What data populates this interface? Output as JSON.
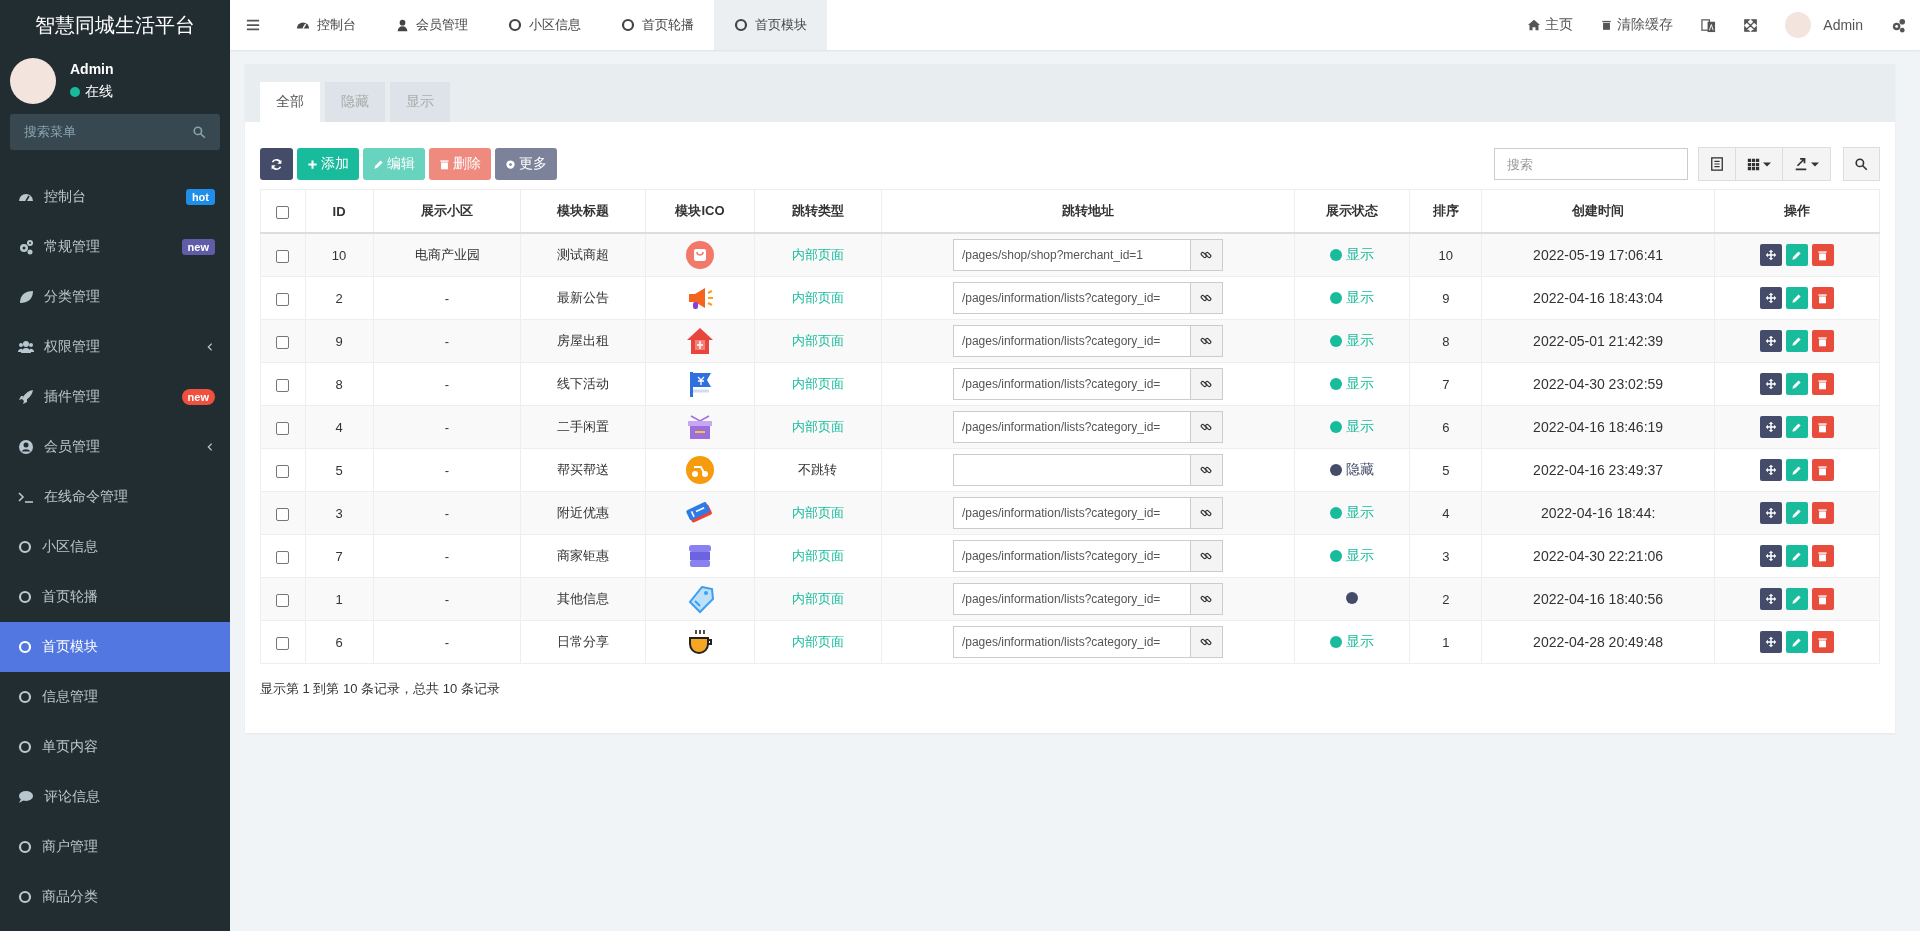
{
  "app_title": "智慧同城生活平台",
  "user": {
    "name": "Admin",
    "status": "在线"
  },
  "menu_search": {
    "placeholder": "搜索菜单"
  },
  "sidebar": {
    "items": [
      {
        "label": "控制台",
        "selected": false,
        "badge": {
          "text": "hot",
          "color": "#1e8ee8"
        }
      },
      {
        "label": "常规管理",
        "selected": false,
        "badge": {
          "text": "new",
          "color": "#605ca8"
        }
      },
      {
        "label": "分类管理",
        "selected": false
      },
      {
        "label": "权限管理",
        "selected": false,
        "expanded": false
      },
      {
        "label": "插件管理",
        "selected": false,
        "badge": {
          "text": "new",
          "color": "#f0503f"
        }
      },
      {
        "label": "会员管理",
        "selected": false,
        "expanded": false
      },
      {
        "label": "在线命令管理",
        "selected": false
      },
      {
        "label": "小区信息",
        "selected": false
      },
      {
        "label": "首页轮播",
        "selected": false
      },
      {
        "label": "首页模块",
        "selected": true
      },
      {
        "label": "信息管理",
        "selected": false
      },
      {
        "label": "单页内容",
        "selected": false
      },
      {
        "label": "评论信息",
        "selected": false
      },
      {
        "label": "商户管理",
        "selected": false
      },
      {
        "label": "商品分类",
        "selected": false
      }
    ]
  },
  "nav_tabs": [
    {
      "label": "控制台",
      "selected": false
    },
    {
      "label": "会员管理",
      "selected": false
    },
    {
      "label": "小区信息",
      "selected": false
    },
    {
      "label": "首页轮播",
      "selected": false
    },
    {
      "label": "首页模块",
      "selected": true
    }
  ],
  "top_right": {
    "home": "主页",
    "clear_cache": "清除缓存",
    "user": "Admin"
  },
  "filter_tabs": [
    {
      "label": "全部",
      "selected": true
    },
    {
      "label": "隐藏",
      "selected": false
    },
    {
      "label": "显示",
      "selected": false
    }
  ],
  "toolbar": {
    "buttons": [
      {
        "kind": "refresh",
        "disabled": false
      },
      {
        "kind": "add",
        "label": "添加",
        "disabled": false
      },
      {
        "kind": "edit",
        "label": "编辑",
        "disabled": true
      },
      {
        "kind": "delete",
        "label": "删除",
        "disabled": true
      },
      {
        "kind": "more",
        "label": "更多",
        "disabled": false
      }
    ],
    "search": {
      "placeholder": "搜索"
    }
  },
  "table": {
    "select_all": {
      "checked": false
    },
    "columns": [
      "ID",
      "展示小区",
      "模块标题",
      "模块ICO",
      "跳转类型",
      "跳转地址",
      "展示状态",
      "排序",
      "创建时间",
      "操作"
    ],
    "rows": [
      {
        "checked": false,
        "id": "10",
        "community": "电商产业园",
        "title": "测试商超",
        "jump_type": {
          "kind": "internal",
          "label": "内部页面"
        },
        "url": "/pages/shop/shop?merchant_id=1",
        "status": {
          "visible": true,
          "label": "显示"
        },
        "sort": "10",
        "created": "2022-05-19 17:06:41"
      },
      {
        "checked": false,
        "id": "2",
        "community": "-",
        "title": "最新公告",
        "jump_type": {
          "kind": "internal",
          "label": "内部页面"
        },
        "url": "/pages/information/lists?category_id=",
        "status": {
          "visible": true,
          "label": "显示"
        },
        "sort": "9",
        "created": "2022-04-16 18:43:04"
      },
      {
        "checked": false,
        "id": "9",
        "community": "-",
        "title": "房屋出租",
        "jump_type": {
          "kind": "internal",
          "label": "内部页面"
        },
        "url": "/pages/information/lists?category_id=",
        "status": {
          "visible": true,
          "label": "显示"
        },
        "sort": "8",
        "created": "2022-05-01 21:42:39"
      },
      {
        "checked": false,
        "id": "8",
        "community": "-",
        "title": "线下活动",
        "jump_type": {
          "kind": "internal",
          "label": "内部页面"
        },
        "url": "/pages/information/lists?category_id=",
        "status": {
          "visible": true,
          "label": "显示"
        },
        "sort": "7",
        "created": "2022-04-30 23:02:59"
      },
      {
        "checked": false,
        "id": "4",
        "community": "-",
        "title": "二手闲置",
        "jump_type": {
          "kind": "internal",
          "label": "内部页面"
        },
        "url": "/pages/information/lists?category_id=",
        "status": {
          "visible": true,
          "label": "显示"
        },
        "sort": "6",
        "created": "2022-04-16 18:46:19"
      },
      {
        "checked": false,
        "id": "5",
        "community": "-",
        "title": "帮买帮送",
        "jump_type": {
          "kind": "none",
          "label": "不跳转"
        },
        "status": {
          "visible": false,
          "label": "隐藏"
        },
        "sort": "5",
        "created": "2022-04-16 23:49:37"
      },
      {
        "checked": false,
        "id": "3",
        "community": "-",
        "title": "附近优惠",
        "jump_type": {
          "kind": "internal",
          "label": "内部页面"
        },
        "url": "/pages/information/lists?category_id=",
        "status": {
          "visible": true,
          "label": "显示"
        },
        "sort": "4",
        "created": "2022-04-16 18:44:"
      },
      {
        "checked": false,
        "id": "7",
        "community": "-",
        "title": "商家钜惠",
        "jump_type": {
          "kind": "internal",
          "label": "内部页面"
        },
        "url": "/pages/information/lists?category_id=",
        "status": {
          "visible": true,
          "label": "显示"
        },
        "sort": "3",
        "created": "2022-04-30 22:21:06"
      },
      {
        "checked": false,
        "id": "1",
        "community": "-",
        "title": "其他信息",
        "jump_type": {
          "kind": "internal",
          "label": "内部页面"
        },
        "url": "/pages/information/lists?category_id=",
        "status": {
          "visible": false
        },
        "sort": "2",
        "created": "2022-04-16 18:40:56"
      },
      {
        "checked": false,
        "id": "6",
        "community": "-",
        "title": "日常分享",
        "jump_type": {
          "kind": "internal",
          "label": "内部页面"
        },
        "url": "/pages/information/lists?category_id=",
        "status": {
          "visible": true,
          "label": "显示"
        },
        "sort": "1",
        "created": "2022-04-28 20:49:48"
      }
    ]
  },
  "pagination_info": "显示第 1 到第 10 条记录，总共 10 条记录"
}
